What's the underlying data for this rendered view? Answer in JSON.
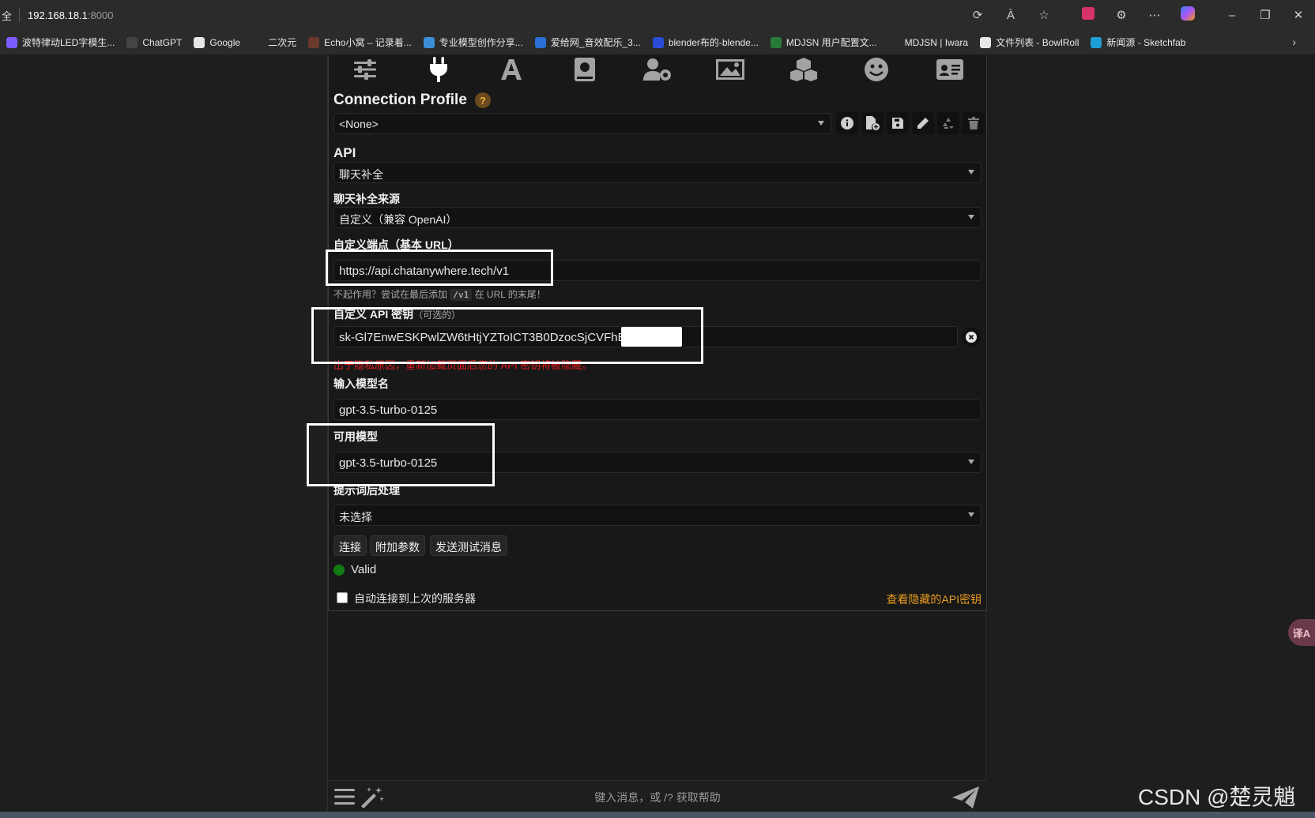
{
  "browser": {
    "left_char": "全",
    "url_host": "192.168.18.1",
    "url_port": ":8000",
    "bookmarks": [
      {
        "label": "波特律动LED字模生...",
        "icon_color": "#7c5cff"
      },
      {
        "label": "ChatGPT",
        "icon_color": "#444444"
      },
      {
        "label": "Google",
        "icon_color": "#e7e7e7"
      },
      {
        "label": "二次元",
        "icon_color": "#2b2b2b"
      },
      {
        "label": "Echo小窝 – 记录着...",
        "icon_color": "#6b3a2a"
      },
      {
        "label": "专业模型创作分享...",
        "icon_color": "#3a8fd6"
      },
      {
        "label": "爱给网_音效配乐_3...",
        "icon_color": "#2a6fd6"
      },
      {
        "label": "blender布的-blende...",
        "icon_color": "#2a4bd6"
      },
      {
        "label": "MDJSN 用户配置文...",
        "icon_color": "#2a7a3a"
      },
      {
        "label": "MDJSN | Iwara",
        "icon_color": "#2b2b2b"
      },
      {
        "label": "文件列表 - BowlRoll",
        "icon_color": "#e7e7e7"
      },
      {
        "label": "新闻源 - Sketchfab",
        "icon_color": "#1ea0d6"
      }
    ]
  },
  "connection": {
    "title": "Connection Profile",
    "help_glyph": "?",
    "profile_value": "<None>"
  },
  "api": {
    "label": "API",
    "value": "聊天补全"
  },
  "source": {
    "label": "聊天补全来源",
    "value": "自定义（兼容 OpenAI）"
  },
  "endpoint": {
    "label": "自定义端点（基本 URL）",
    "value": "https://api.chatanywhere.tech/v1",
    "hint_before": "不起作用？尝试在最后添加",
    "hint_code": "/v1",
    "hint_after": "在 URL 的末尾！"
  },
  "api_key": {
    "label": "自定义 API 密钥",
    "optional": "（可选的）",
    "value": "sk-Gl7EnwESKPwlZW6tHtjYZToICT3B0DzocSjCVFhB",
    "warning": "出于隐私原因，重新加载页面后您的 API 密钥将被隐藏。"
  },
  "model_name": {
    "label": "输入模型名",
    "value": "gpt-3.5-turbo-0125"
  },
  "available_models": {
    "label": "可用模型",
    "value": "gpt-3.5-turbo-0125"
  },
  "postprocess": {
    "label": "提示词后处理",
    "value": "未选择"
  },
  "buttons": {
    "connect": "连接",
    "extra_params": "附加参数",
    "send_test": "发送测试消息"
  },
  "status": {
    "text": "Valid",
    "color": "#127a12"
  },
  "auto_connect": {
    "label": "自动连接到上次的服务器",
    "checked": false
  },
  "reveal_link": "查看隐藏的API密钥",
  "composer": {
    "placeholder": "键入消息，或 /? 获取帮助"
  },
  "translate_fab": "译A",
  "watermark": "CSDN @楚灵魈"
}
